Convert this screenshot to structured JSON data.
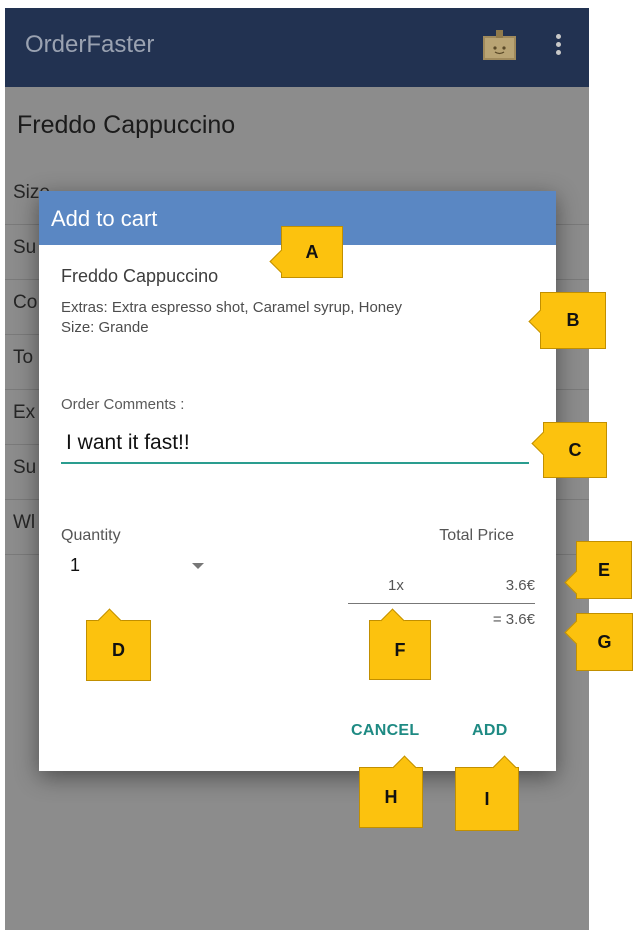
{
  "app": {
    "title": "OrderFaster",
    "icons": [
      "cart-icon",
      "more-vert-icon"
    ]
  },
  "background": {
    "product_title": "Freddo Cappuccino",
    "rows": [
      "Size",
      "Su",
      "Co",
      "To",
      "Ex",
      "Su",
      "Wl"
    ]
  },
  "dialog": {
    "title": "Add to cart",
    "product_name": "Freddo Cappuccino",
    "extras": "Extras: Extra espresso shot, Caramel syrup, Honey",
    "size": "Size: Grande",
    "comments_label": "Order Comments :",
    "comments_value": "I want it fast!!",
    "quantity_label": "Quantity",
    "quantity_value": "1",
    "total_label": "Total Price",
    "line_qty": "1x",
    "line_price": "3.6€",
    "total_value": "= 3.6€",
    "cancel_label": "CANCEL",
    "add_label": "ADD"
  },
  "annotations": [
    "A",
    "B",
    "C",
    "D",
    "E",
    "F",
    "G",
    "H",
    "I"
  ],
  "colors": {
    "appbar": "#223251",
    "dialog_header": "#5a87c3",
    "accent": "#2a9d8f",
    "marker": "#fcc20e"
  }
}
